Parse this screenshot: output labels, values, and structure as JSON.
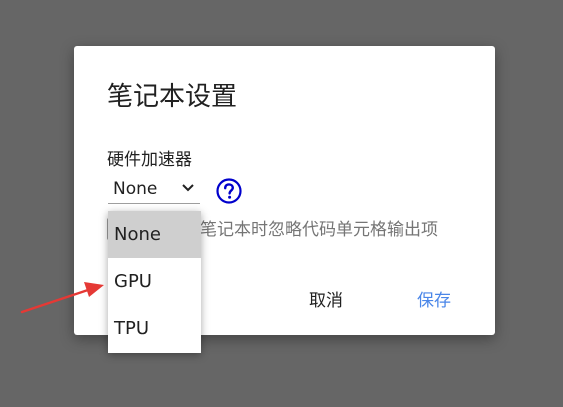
{
  "dialog": {
    "title": "笔记本设置",
    "hardware_accelerator": {
      "label": "硬件加速器",
      "selected_value": "None",
      "options": [
        "None",
        "GPU",
        "TPU"
      ]
    },
    "omit_output_label": "笔记本时忽略代码单元格输出项",
    "cancel_label": "取消",
    "save_label": "保存"
  },
  "colors": {
    "overlay": "#666666",
    "help_icon": "#0000cc",
    "save_button": "#4a86e8",
    "arrow": "#e53935"
  },
  "icons": {
    "help": "question-circle-icon",
    "dropdown": "chevron-down-icon",
    "annotation": "red-arrow"
  }
}
